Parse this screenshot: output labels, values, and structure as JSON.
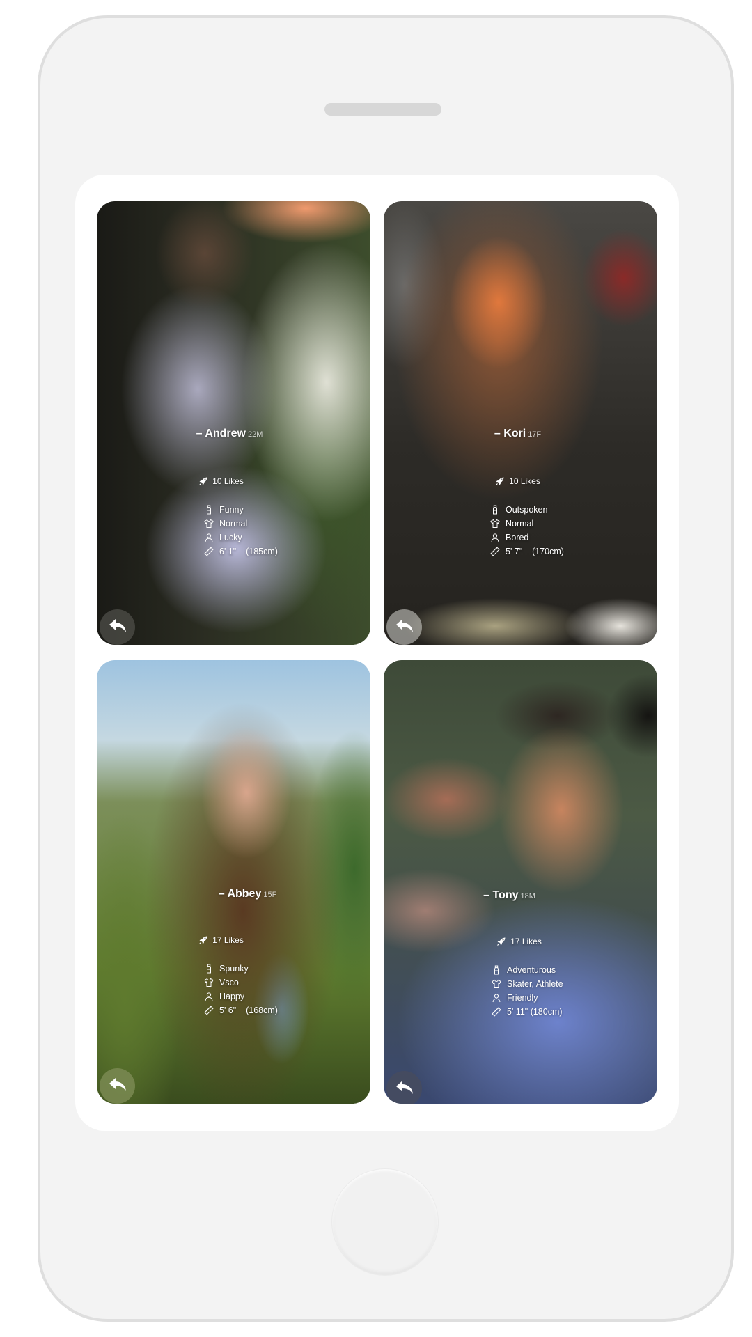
{
  "colors": {
    "phone_body": "#f3f3f3",
    "screen": "#ffffff",
    "text": "#ffffff"
  },
  "icons": {
    "likes": "rocket-icon",
    "personality": "bottle-icon",
    "style": "shirt-icon",
    "mood": "person-icon",
    "height": "ruler-icon",
    "share": "reply-arrow-icon"
  },
  "profiles": [
    {
      "name": "– Andrew",
      "age_gender": "22M",
      "likes": "10 Likes",
      "personality": "Funny",
      "style": "Normal",
      "mood": "Lucky",
      "height": "6' 1\"    (185cm)"
    },
    {
      "name": "– Kori",
      "age_gender": "17F",
      "likes": "10 Likes",
      "personality": "Outspoken",
      "style": "Normal",
      "mood": "Bored",
      "height": "5' 7\"    (170cm)"
    },
    {
      "name": "– Abbey",
      "age_gender": "15F",
      "likes": "17 Likes",
      "personality": "Spunky",
      "style": "Vsco",
      "mood": "Happy",
      "height": "5' 6\"    (168cm)"
    },
    {
      "name": "– Tony",
      "age_gender": "18M",
      "likes": "17 Likes",
      "personality": "Adventurous",
      "style": "Skater, Athlete",
      "mood": "Friendly",
      "height": "5' 11\" (180cm)"
    }
  ]
}
